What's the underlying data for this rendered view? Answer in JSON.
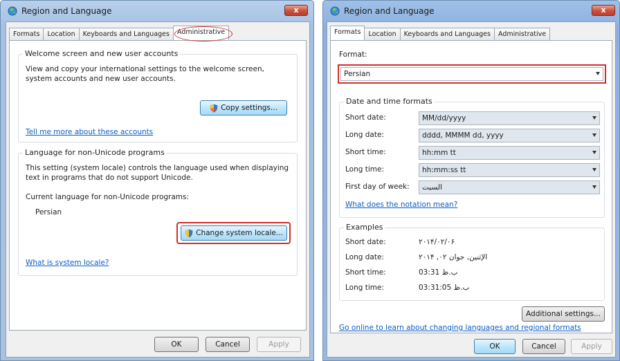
{
  "left_window": {
    "title": "Region and Language",
    "close_label": "x",
    "tabs": [
      "Formats",
      "Location",
      "Keyboards and Languages",
      "Administrative"
    ],
    "welcome_group": {
      "title": "Welcome screen and new user accounts",
      "description": "View and copy your international settings to the welcome screen, system accounts and new user accounts.",
      "copy_button": "Copy settings...",
      "link": "Tell me more about these accounts"
    },
    "nonunicode_group": {
      "title": "Language for non-Unicode programs",
      "description": "This setting (system locale) controls the language used when displaying text in programs that do not support Unicode.",
      "current_label": "Current language for non-Unicode programs:",
      "current_value": "Persian",
      "change_button": "Change system locale...",
      "link": "What is system locale?"
    },
    "footer": {
      "ok": "OK",
      "cancel": "Cancel",
      "apply": "Apply"
    }
  },
  "right_window": {
    "title": "Region and Language",
    "close_label": "x",
    "tabs": [
      "Formats",
      "Location",
      "Keyboards and Languages",
      "Administrative"
    ],
    "format_label": "Format:",
    "format_value": "Persian",
    "datetime_group": {
      "title": "Date and time formats",
      "rows": [
        {
          "label": "Short date:",
          "value": "MM/dd/yyyy"
        },
        {
          "label": "Long date:",
          "value": "dddd, MMMM dd, yyyy"
        },
        {
          "label": "Short time:",
          "value": "hh:mm tt"
        },
        {
          "label": "Long time:",
          "value": "hh:mm:ss tt"
        },
        {
          "label": "First day of week:",
          "value": "السبت"
        }
      ],
      "notation_link": "What does the notation mean?"
    },
    "examples_group": {
      "title": "Examples",
      "rows": [
        {
          "label": "Short date:",
          "value": "۲۰۱۴/۰۲/۰۶"
        },
        {
          "label": "Long date:",
          "value": "الإثنين, جوان ۰۲, ۲۰۱۴"
        },
        {
          "label": "Short time:",
          "value": "03:31 ب.ظ"
        },
        {
          "label": "Long time:",
          "value": "03:31:05 ب.ظ"
        }
      ]
    },
    "additional_button": "Additional settings...",
    "online_link": "Go online to learn about changing languages and regional formats",
    "footer": {
      "ok": "OK",
      "cancel": "Cancel",
      "apply": "Apply"
    }
  },
  "colors": {
    "highlight": "#d42c2c",
    "link": "#0b5dc6",
    "focus_button": "#bee6fd"
  }
}
